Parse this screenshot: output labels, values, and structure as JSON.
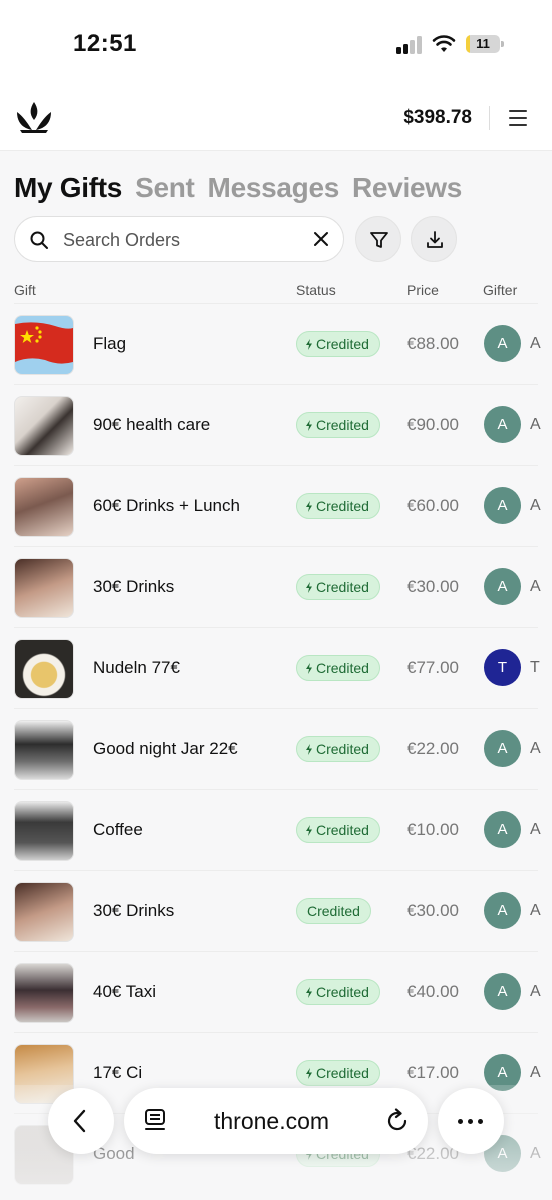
{
  "status_bar": {
    "time": "12:51",
    "battery": "11",
    "battery_level": 0.11
  },
  "header": {
    "balance": "$398.78",
    "logo_icon": "crown-logo-icon",
    "menu_icon": "hamburger-menu-icon"
  },
  "tabs": [
    {
      "label": "My Gifts",
      "active": true
    },
    {
      "label": "Sent",
      "active": false
    },
    {
      "label": "Messages",
      "active": false
    },
    {
      "label": "Reviews",
      "active": false
    }
  ],
  "search": {
    "placeholder": "Search Orders",
    "value": ""
  },
  "columns": {
    "gift": "Gift",
    "status": "Status",
    "price": "Price",
    "gifter": "Gifter"
  },
  "rows": [
    {
      "name": "Flag",
      "status": "Credited",
      "bolt": true,
      "price": "€88.00",
      "gifter_initial": "A",
      "gifter_cut": "A",
      "avatar_color": "#5e8f84"
    },
    {
      "name": "90€ health care",
      "status": "Credited",
      "bolt": true,
      "price": "€90.00",
      "gifter_initial": "A",
      "gifter_cut": "A",
      "avatar_color": "#5e8f84"
    },
    {
      "name": "60€ Drinks + Lunch",
      "status": "Credited",
      "bolt": true,
      "price": "€60.00",
      "gifter_initial": "A",
      "gifter_cut": "A",
      "avatar_color": "#5e8f84"
    },
    {
      "name": "30€ Drinks",
      "status": "Credited",
      "bolt": true,
      "price": "€30.00",
      "gifter_initial": "A",
      "gifter_cut": "A",
      "avatar_color": "#5e8f84"
    },
    {
      "name": "Nudeln 77€",
      "status": "Credited",
      "bolt": true,
      "price": "€77.00",
      "gifter_initial": "T",
      "gifter_cut": "T",
      "avatar_color": "#1f2594"
    },
    {
      "name": "Good night Jar 22€",
      "status": "Credited",
      "bolt": true,
      "price": "€22.00",
      "gifter_initial": "A",
      "gifter_cut": "A",
      "avatar_color": "#5e8f84"
    },
    {
      "name": "Coffee",
      "status": "Credited",
      "bolt": true,
      "price": "€10.00",
      "gifter_initial": "A",
      "gifter_cut": "A",
      "avatar_color": "#5e8f84"
    },
    {
      "name": "30€ Drinks",
      "status": "Credited",
      "bolt": false,
      "price": "€30.00",
      "gifter_initial": "A",
      "gifter_cut": "A",
      "avatar_color": "#5e8f84"
    },
    {
      "name": "40€ Taxi",
      "status": "Credited",
      "bolt": true,
      "price": "€40.00",
      "gifter_initial": "A",
      "gifter_cut": "A",
      "avatar_color": "#5e8f84"
    },
    {
      "name": "17€ Ci",
      "status": "Credited",
      "bolt": true,
      "price": "€17.00",
      "gifter_initial": "A",
      "gifter_cut": "A",
      "avatar_color": "#5e8f84"
    },
    {
      "name": "Good",
      "status": "Credited",
      "bolt": true,
      "price": "€22.00",
      "gifter_initial": "A",
      "gifter_cut": "A",
      "avatar_color": "#5e8f84"
    }
  ],
  "browser": {
    "url": "throne.com"
  },
  "colors": {
    "accent_green": "#d7f2dc",
    "credited_text": "#1f6b35",
    "avatar_teal": "#5e8f84",
    "avatar_blue": "#1f2594"
  }
}
